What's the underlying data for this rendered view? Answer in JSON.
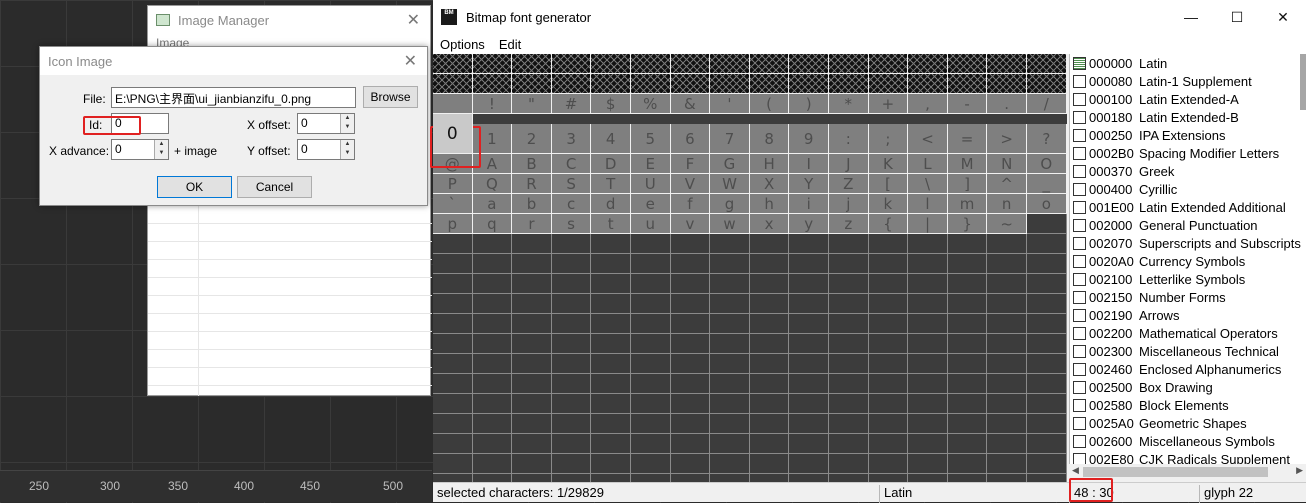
{
  "ruler": {
    "ticks": [
      "250",
      "300",
      "350",
      "400",
      "450",
      "500"
    ]
  },
  "image_manager": {
    "title": "Image Manager",
    "subtitle": "Image"
  },
  "icon_dialog": {
    "title": "Icon Image",
    "file_label": "File:",
    "file_value": "E:\\PNG\\主界面\\ui_jianbianzifu_0.png",
    "browse_label": "Browse",
    "id_label": "Id:",
    "id_value": "0",
    "x_offset_label": "X offset:",
    "x_offset_value": "0",
    "x_advance_label": "X advance:",
    "x_advance_value": "0",
    "plus_image_label": "+ image",
    "y_offset_label": "Y offset:",
    "y_offset_value": "0",
    "ok_label": "OK",
    "cancel_label": "Cancel"
  },
  "bfg": {
    "title": "Bitmap font generator",
    "app_icon_text": "BM",
    "menu": [
      "Options",
      "Edit"
    ],
    "glyph_rows": [
      [
        "",
        "!",
        "\"",
        "#",
        "$",
        "%",
        "&",
        "'",
        "(",
        ")",
        "*",
        "+",
        ",",
        "-",
        ".",
        "/"
      ],
      [
        "0",
        "1",
        "2",
        "3",
        "4",
        "5",
        "6",
        "7",
        "8",
        "9",
        ":",
        ";",
        "<",
        "=",
        ">",
        "?"
      ],
      [
        "@",
        "A",
        "B",
        "C",
        "D",
        "E",
        "F",
        "G",
        "H",
        "I",
        "J",
        "K",
        "L",
        "M",
        "N",
        "O"
      ],
      [
        "P",
        "Q",
        "R",
        "S",
        "T",
        "U",
        "V",
        "W",
        "X",
        "Y",
        "Z",
        "[",
        "\\",
        "]",
        "^",
        "_"
      ],
      [
        "`",
        "a",
        "b",
        "c",
        "d",
        "e",
        "f",
        "g",
        "h",
        "i",
        "j",
        "k",
        "l",
        "m",
        "n",
        "o"
      ],
      [
        "p",
        "q",
        "r",
        "s",
        "t",
        "u",
        "v",
        "w",
        "x",
        "y",
        "z",
        "{",
        "|",
        "}",
        "~",
        ""
      ]
    ],
    "selected_glyph": "0",
    "ranges": [
      {
        "code": "000000",
        "name": "Latin",
        "state": "partial"
      },
      {
        "code": "000080",
        "name": "Latin-1 Supplement"
      },
      {
        "code": "000100",
        "name": "Latin Extended-A"
      },
      {
        "code": "000180",
        "name": "Latin Extended-B"
      },
      {
        "code": "000250",
        "name": "IPA Extensions"
      },
      {
        "code": "0002B0",
        "name": "Spacing Modifier Letters"
      },
      {
        "code": "000370",
        "name": "Greek"
      },
      {
        "code": "000400",
        "name": "Cyrillic"
      },
      {
        "code": "001E00",
        "name": "Latin Extended Additional"
      },
      {
        "code": "002000",
        "name": "General Punctuation"
      },
      {
        "code": "002070",
        "name": "Superscripts and Subscripts"
      },
      {
        "code": "0020A0",
        "name": "Currency Symbols"
      },
      {
        "code": "002100",
        "name": "Letterlike Symbols"
      },
      {
        "code": "002150",
        "name": "Number Forms"
      },
      {
        "code": "002190",
        "name": "Arrows"
      },
      {
        "code": "002200",
        "name": "Mathematical Operators"
      },
      {
        "code": "002300",
        "name": "Miscellaneous Technical"
      },
      {
        "code": "002460",
        "name": "Enclosed Alphanumerics"
      },
      {
        "code": "002500",
        "name": "Box Drawing"
      },
      {
        "code": "002580",
        "name": "Block Elements"
      },
      {
        "code": "0025A0",
        "name": "Geometric Shapes"
      },
      {
        "code": "002600",
        "name": "Miscellaneous Symbols"
      },
      {
        "code": "002E80",
        "name": "CJK Radicals Supplement"
      }
    ],
    "status": {
      "selected": "selected characters: 1/29829",
      "range": "Latin",
      "code": "48 : 30",
      "glyph": "glyph 22"
    }
  }
}
